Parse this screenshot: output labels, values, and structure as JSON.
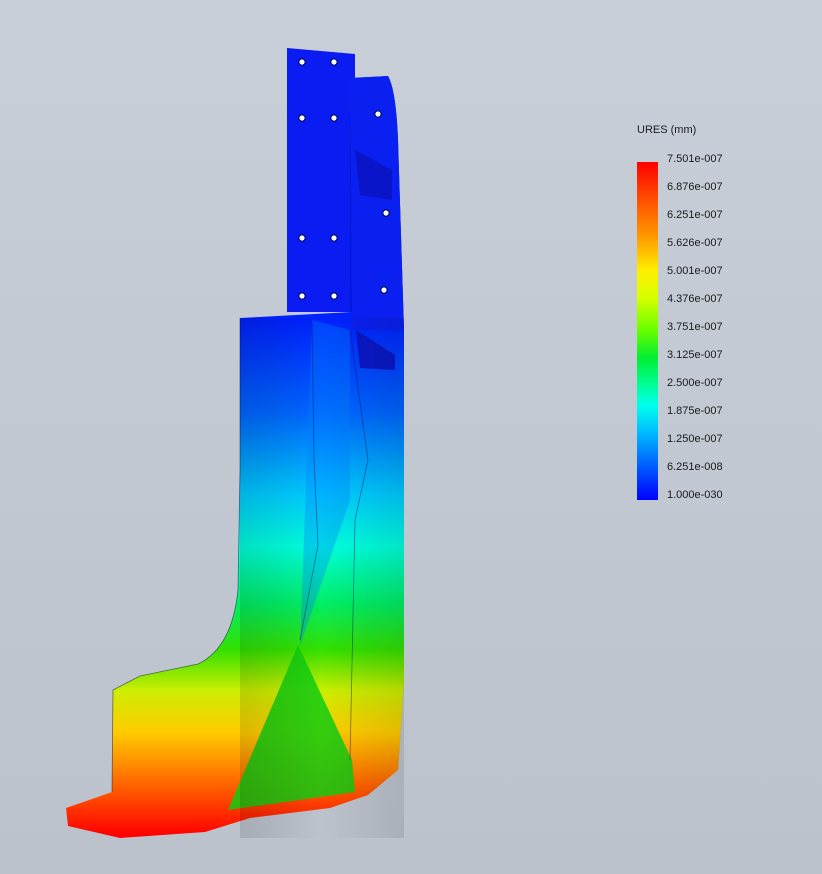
{
  "window": {
    "background_top": "#c9cfd9",
    "background_bottom": "#bcc2cc"
  },
  "plot": {
    "quantity": "URES (mm)",
    "colormap": [
      "#ff0000",
      "#ff9900",
      "#ffee00",
      "#66ff00",
      "#00ee33",
      "#00ffee",
      "#00bbff",
      "#0000ff"
    ]
  },
  "legend": {
    "title": "URES (mm)",
    "labels": [
      "7.501e-007",
      "6.876e-007",
      "6.251e-007",
      "5.626e-007",
      "5.001e-007",
      "4.376e-007",
      "3.751e-007",
      "3.125e-007",
      "2.500e-007",
      "1.875e-007",
      "1.250e-007",
      "6.251e-008",
      "1.000e-030"
    ]
  }
}
